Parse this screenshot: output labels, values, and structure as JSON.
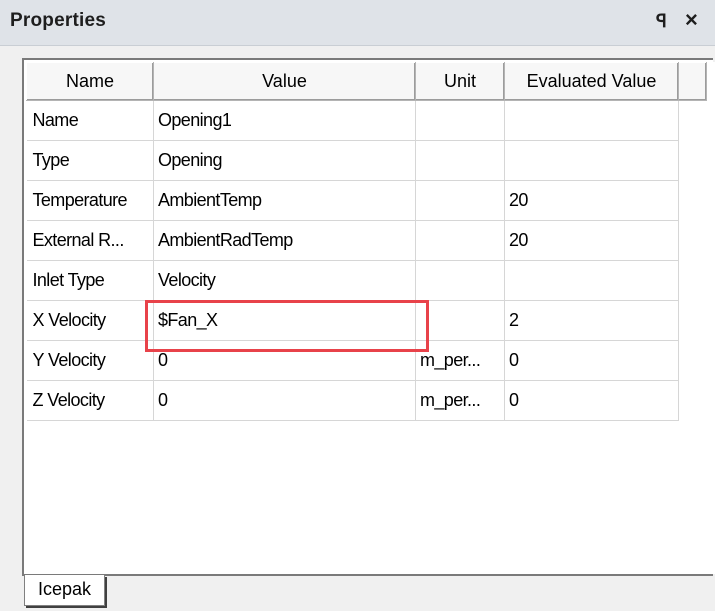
{
  "window": {
    "title": "Properties",
    "pin_glyph": "ꟼ",
    "close_glyph": "×"
  },
  "columns": [
    "Name",
    "Value",
    "Unit",
    "Evaluated Value"
  ],
  "rows": [
    {
      "name": "Name",
      "value": "Opening1",
      "unit": "",
      "evaluated": ""
    },
    {
      "name": "Type",
      "value": "Opening",
      "unit": "",
      "evaluated": ""
    },
    {
      "name": "Temperature",
      "value": "AmbientTemp",
      "unit": "",
      "evaluated": "20"
    },
    {
      "name": "External R...",
      "value": "AmbientRadTemp",
      "unit": "",
      "evaluated": "20"
    },
    {
      "name": "Inlet Type",
      "value": "Velocity",
      "unit": "",
      "evaluated": ""
    },
    {
      "name": "X Velocity",
      "value": "$Fan_X",
      "unit": "",
      "evaluated": "2"
    },
    {
      "name": "Y Velocity",
      "value": "0",
      "unit": "m_per...",
      "evaluated": "0"
    },
    {
      "name": "Z Velocity",
      "value": "0",
      "unit": "m_per...",
      "evaluated": "0"
    }
  ],
  "tabs": [
    "Icepak"
  ],
  "colors": {
    "highlight": "#e8424a",
    "titlebar": "#dfe3e8"
  }
}
